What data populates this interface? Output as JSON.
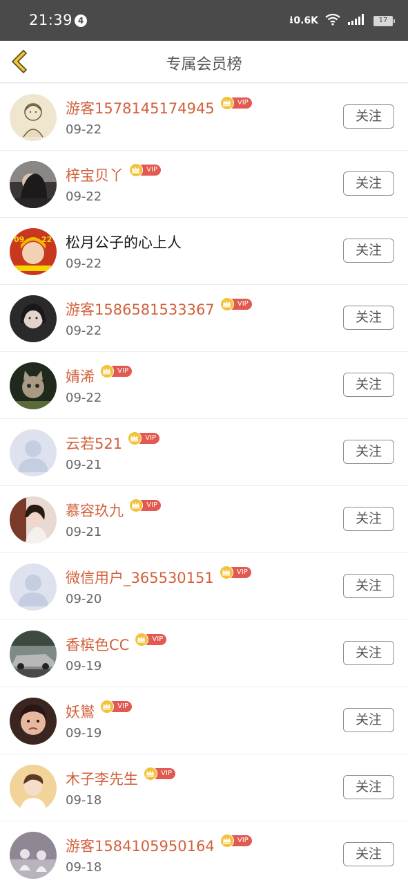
{
  "status_bar": {
    "time": "21:39",
    "notification_count": "4",
    "net_speed": "0.6K",
    "battery": "17"
  },
  "header": {
    "title": "专属会员榜"
  },
  "members": [
    {
      "name": "游客1578145174945",
      "date": "09-22",
      "vip": true,
      "vip_label": "VIP",
      "follow_label": "关注",
      "avatar": "sketch-avatar"
    },
    {
      "name": "梓宝贝丫",
      "date": "09-22",
      "vip": true,
      "vip_label": "VIP",
      "follow_label": "关注",
      "avatar": "dark-hair-avatar"
    },
    {
      "name": "松月公子的心上人",
      "date": "09-22",
      "vip": false,
      "vip_label": "",
      "follow_label": "关注",
      "avatar": "red-poster-avatar"
    },
    {
      "name": "游客1586581533367",
      "date": "09-22",
      "vip": true,
      "vip_label": "VIP",
      "follow_label": "关注",
      "avatar": "girl-avatar"
    },
    {
      "name": "婧浠",
      "date": "09-22",
      "vip": true,
      "vip_label": "VIP",
      "follow_label": "关注",
      "avatar": "kitten-avatar"
    },
    {
      "name": "云若521",
      "date": "09-21",
      "vip": true,
      "vip_label": "VIP",
      "follow_label": "关注",
      "avatar": "default-avatar"
    },
    {
      "name": "慕容玖九",
      "date": "09-21",
      "vip": true,
      "vip_label": "VIP",
      "follow_label": "关注",
      "avatar": "selfie-avatar"
    },
    {
      "name": "微信用户_365530151",
      "date": "09-20",
      "vip": true,
      "vip_label": "VIP",
      "follow_label": "关注",
      "avatar": "default-avatar"
    },
    {
      "name": "香槟色CC",
      "date": "09-19",
      "vip": true,
      "vip_label": "VIP",
      "follow_label": "关注",
      "avatar": "car-avatar"
    },
    {
      "name": "妖鸑",
      "date": "09-19",
      "vip": true,
      "vip_label": "VIP",
      "follow_label": "关注",
      "avatar": "face-avatar"
    },
    {
      "name": "木子李先生",
      "date": "09-18",
      "vip": true,
      "vip_label": "VIP",
      "follow_label": "关注",
      "avatar": "boy-avatar"
    },
    {
      "name": "游客1584105950164",
      "date": "09-18",
      "vip": true,
      "vip_label": "VIP",
      "follow_label": "关注",
      "avatar": "doll-avatar"
    }
  ],
  "colors": {
    "status_bar_bg": "#4a4a4a",
    "vip_name": "#d2603a",
    "vip_tag": "#e25a4f",
    "crown": "#f2c23a",
    "back_arrow_fill": "#f2c23a"
  }
}
